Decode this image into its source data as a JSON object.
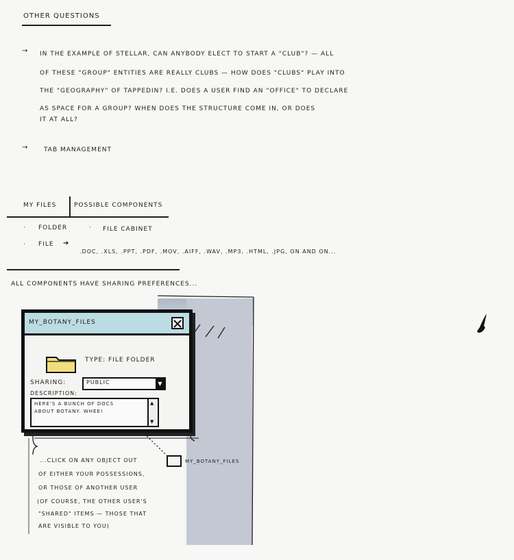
{
  "heading": "OTHER QUESTIONS",
  "questions": {
    "lines": [
      "IN THE EXAMPLE OF STELLAR, CAN ANYBODY ELECT TO START A \"CLUB\"? — ALL",
      "OF THESE \"GROUP\" ENTITIES ARE REALLY CLUBS — HOW DOES \"CLUBS\" PLAY INTO",
      "THE \"GEOGRAPHY\" OF TAPPEDIN? I.E. DOES A USER FIND AN \"OFFICE\" TO DECLARE",
      "AS SPACE FOR A GROUP? WHEN DOES THE STRUCTURE COME IN, OR DOES",
      "IT AT ALL?"
    ],
    "tab_management": "TAB MANAGEMENT"
  },
  "my_files": {
    "header_left": "MY FILES",
    "header_right": "POSSIBLE COMPONENTS",
    "folder": "FOLDER",
    "file_cabinet": "FILE CABINET",
    "file": "FILE",
    "file_types": ".DOC, .XLS, .PPT, .PDF, .MOV, .AIFF, .WAV, .MP3, .HTML, .JPG, ON AND ON..."
  },
  "sharing_note": "ALL COMPONENTS HAVE SHARING PREFERENCES...",
  "dialog": {
    "title": "MY_BOTANY_FILES",
    "type_text": "TYPE: FILE FOLDER",
    "sharing_label": "SHARING:",
    "sharing_value": "PUBLIC",
    "description_label": "DESCRIPTION:",
    "description_line1": "HERE'S A BUNCH OF DOCS",
    "description_line2": "ABOUT BOTANY. WHEE!"
  },
  "small_file_label": "MY_BOTANY_FILES",
  "click_note": [
    "...CLICK ON ANY OBJECT OUT",
    "OF EITHER YOUR POSSESSIONS,",
    "OR THOSE OF ANOTHER USER",
    "(OF COURSE, THE OTHER USER'S",
    "\"SHARED\" ITEMS — THOSE THAT",
    "ARE VISIBLE TO YOU)"
  ],
  "colors": {
    "ink": "#1e1e1e",
    "titlebar": "#bcdce3",
    "folder": "#f2de7e",
    "grey_panel": "#c4c8d3"
  }
}
